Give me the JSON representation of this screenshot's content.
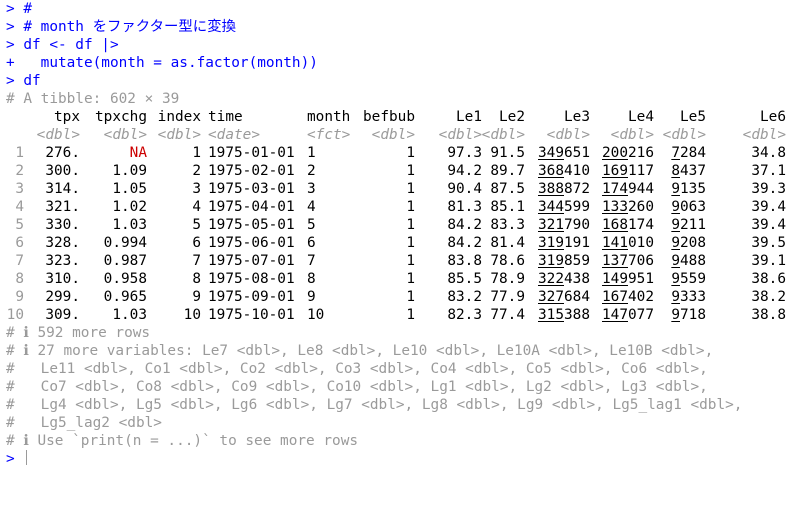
{
  "console": {
    "lines": [
      {
        "kind": "code",
        "text": "> #"
      },
      {
        "kind": "code",
        "text": "> # month をファクター型に変換"
      },
      {
        "kind": "code",
        "text": "> df <- df |>"
      },
      {
        "kind": "code",
        "text": "+   mutate(month = as.factor(month))"
      },
      {
        "kind": "code",
        "text": "> df"
      },
      {
        "kind": "comment",
        "text": "# A tibble: 602 × 39"
      }
    ],
    "columns": [
      "tpx",
      "tpxchg",
      "index",
      "time",
      "month",
      "befbub",
      "Le1",
      "Le2",
      "Le3",
      "Le4",
      "Le5",
      "Le6"
    ],
    "types": [
      "<dbl>",
      "<dbl>",
      "<dbl>",
      "<date>",
      "<fct>",
      "<dbl>",
      "<dbl>",
      "<dbl>",
      "<dbl>",
      "<dbl>",
      "<dbl>",
      "<dbl>"
    ],
    "rows": [
      {
        "n": "1",
        "tpx": "276.",
        "tpxchg": "NA",
        "index": "1",
        "time": "1975-01-01",
        "month": "1",
        "befbub": "1",
        "Le1": "97.3",
        "Le2": "91.5",
        "Le3": "349651",
        "Le4": "200216",
        "Le5": "7284",
        "Le6": "34.8"
      },
      {
        "n": "2",
        "tpx": "300.",
        "tpxchg": "1.09",
        "index": "2",
        "time": "1975-02-01",
        "month": "2",
        "befbub": "1",
        "Le1": "94.2",
        "Le2": "89.7",
        "Le3": "368410",
        "Le4": "169117",
        "Le5": "8437",
        "Le6": "37.1"
      },
      {
        "n": "3",
        "tpx": "314.",
        "tpxchg": "1.05",
        "index": "3",
        "time": "1975-03-01",
        "month": "3",
        "befbub": "1",
        "Le1": "90.4",
        "Le2": "87.5",
        "Le3": "388872",
        "Le4": "174944",
        "Le5": "9135",
        "Le6": "39.3"
      },
      {
        "n": "4",
        "tpx": "321.",
        "tpxchg": "1.02",
        "index": "4",
        "time": "1975-04-01",
        "month": "4",
        "befbub": "1",
        "Le1": "81.3",
        "Le2": "85.1",
        "Le3": "344599",
        "Le4": "133260",
        "Le5": "9063",
        "Le6": "39.4"
      },
      {
        "n": "5",
        "tpx": "330.",
        "tpxchg": "1.03",
        "index": "5",
        "time": "1975-05-01",
        "month": "5",
        "befbub": "1",
        "Le1": "84.2",
        "Le2": "83.3",
        "Le3": "321790",
        "Le4": "168174",
        "Le5": "9211",
        "Le6": "39.4"
      },
      {
        "n": "6",
        "tpx": "328.",
        "tpxchg": "0.994",
        "index": "6",
        "time": "1975-06-01",
        "month": "6",
        "befbub": "1",
        "Le1": "84.2",
        "Le2": "81.4",
        "Le3": "319191",
        "Le4": "141010",
        "Le5": "9208",
        "Le6": "39.5"
      },
      {
        "n": "7",
        "tpx": "323.",
        "tpxchg": "0.987",
        "index": "7",
        "time": "1975-07-01",
        "month": "7",
        "befbub": "1",
        "Le1": "83.8",
        "Le2": "78.6",
        "Le3": "319859",
        "Le4": "137706",
        "Le5": "9488",
        "Le6": "39.1"
      },
      {
        "n": "8",
        "tpx": "310.",
        "tpxchg": "0.958",
        "index": "8",
        "time": "1975-08-01",
        "month": "8",
        "befbub": "1",
        "Le1": "85.5",
        "Le2": "78.9",
        "Le3": "322438",
        "Le4": "149951",
        "Le5": "9559",
        "Le6": "38.6"
      },
      {
        "n": "9",
        "tpx": "299.",
        "tpxchg": "0.965",
        "index": "9",
        "time": "1975-09-01",
        "month": "9",
        "befbub": "1",
        "Le1": "83.2",
        "Le2": "77.9",
        "Le3": "327684",
        "Le4": "167402",
        "Le5": "9333",
        "Le6": "38.2"
      },
      {
        "n": "10",
        "tpx": "309.",
        "tpxchg": "1.03",
        "index": "10",
        "time": "1975-10-01",
        "month": "10",
        "befbub": "1",
        "Le1": "82.3",
        "Le2": "77.4",
        "Le3": "315388",
        "Le4": "147077",
        "Le5": "9718",
        "Le6": "38.8"
      }
    ],
    "footer": [
      "# ℹ 592 more rows",
      "# ℹ 27 more variables: Le7 <dbl>, Le8 <dbl>, Le10 <dbl>, Le10A <dbl>, Le10B <dbl>,",
      "#   Le11 <dbl>, Co1 <dbl>, Co2 <dbl>, Co3 <dbl>, Co4 <dbl>, Co5 <dbl>, Co6 <dbl>,",
      "#   Co7 <dbl>, Co8 <dbl>, Co9 <dbl>, Co10 <dbl>, Lg1 <dbl>, Lg2 <dbl>, Lg3 <dbl>,",
      "#   Lg4 <dbl>, Lg5 <dbl>, Lg6 <dbl>, Lg7 <dbl>, Lg8 <dbl>, Lg9 <dbl>, Lg5_lag1 <dbl>,",
      "#   Lg5_lag2 <dbl>",
      "# ℹ Use `print(n = ...)` to see more rows"
    ],
    "prompt": ">"
  },
  "colors": {
    "code": "#0000ff",
    "comment": "#9a9a9a",
    "text": "#000000",
    "na": "#cc0000"
  }
}
